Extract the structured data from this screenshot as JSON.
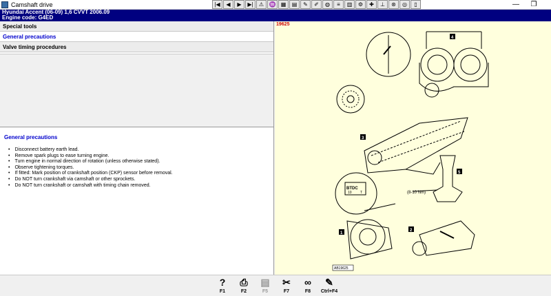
{
  "window": {
    "title": "Camshaft drive"
  },
  "window_controls": {
    "minimize": "—",
    "restore": "❐"
  },
  "toolbar": {
    "buttons": [
      {
        "icon": "first-icon",
        "glyph": "|◀"
      },
      {
        "icon": "previous-icon",
        "glyph": "◀"
      },
      {
        "icon": "next-icon",
        "glyph": "▶"
      },
      {
        "icon": "last-icon",
        "glyph": "▶|"
      },
      {
        "icon": "warning-icon",
        "glyph": "⚠"
      },
      {
        "icon": "wrench-data-icon",
        "glyph": "♒"
      },
      {
        "icon": "table-icon",
        "glyph": "▦"
      },
      {
        "icon": "chart-icon",
        "glyph": "▤"
      },
      {
        "icon": "tool-icon",
        "glyph": "✎"
      },
      {
        "icon": "edit-icon",
        "glyph": "✐"
      },
      {
        "icon": "globe-icon",
        "glyph": "◍"
      },
      {
        "icon": "fuse-icon",
        "glyph": "≡"
      },
      {
        "icon": "diagram-icon",
        "glyph": "▥"
      },
      {
        "icon": "service-icon",
        "glyph": "⚙"
      },
      {
        "icon": "engine-icon",
        "glyph": "✚"
      },
      {
        "icon": "lift-icon",
        "glyph": "⊥"
      },
      {
        "icon": "brake-icon",
        "glyph": "⊛"
      },
      {
        "icon": "tyre-icon",
        "glyph": "◎"
      },
      {
        "icon": "book-icon",
        "glyph": "▯"
      }
    ]
  },
  "vehicle": {
    "line1": "Hyundai   Accent (06-09) 1,6 CVVT 2006.09",
    "line2": "Engine code: G4ED"
  },
  "menu": {
    "items": [
      {
        "label": "Special tools",
        "selected": false
      },
      {
        "label": "General precautions",
        "selected": true
      },
      {
        "label": "Valve timing procedures",
        "selected": false
      }
    ]
  },
  "content": {
    "title": "General precautions",
    "bullets": [
      "Disconnect battery earth lead.",
      "Remove spark plugs to ease turning engine.",
      "Turn engine in normal direction of rotation (unless otherwise stated).",
      "Observe tightening torques.",
      "If fitted: Mark position of crankshaft position (CKP) sensor before removal.",
      "Do NOT turn crankshaft via camshaft or other sprockets.",
      "Do NOT turn crankshaft or camshaft with timing chain removed."
    ]
  },
  "figure": {
    "ref": "19625",
    "id_label": "AB19625",
    "torque_label": "(8-10 Nm)",
    "callouts": [
      "1",
      "2",
      "3",
      "4",
      "5"
    ],
    "btdc_label": "BTDC",
    "btdc_value": "10",
    "t_label": "T"
  },
  "fkeys": [
    {
      "label": "F1",
      "icon": "help-icon",
      "glyph": "?",
      "enabled": true
    },
    {
      "label": "F2",
      "icon": "print-icon",
      "glyph": "⎙",
      "enabled": true
    },
    {
      "label": "F5",
      "icon": "manual-icon",
      "glyph": "▤",
      "enabled": false
    },
    {
      "label": "F7",
      "icon": "tools-icon",
      "glyph": "✂",
      "enabled": true
    },
    {
      "label": "F8",
      "icon": "belt-icon",
      "glyph": "∞",
      "enabled": true
    },
    {
      "label": "Ctrl+F4",
      "icon": "notes-icon",
      "glyph": "✎",
      "enabled": true
    }
  ]
}
